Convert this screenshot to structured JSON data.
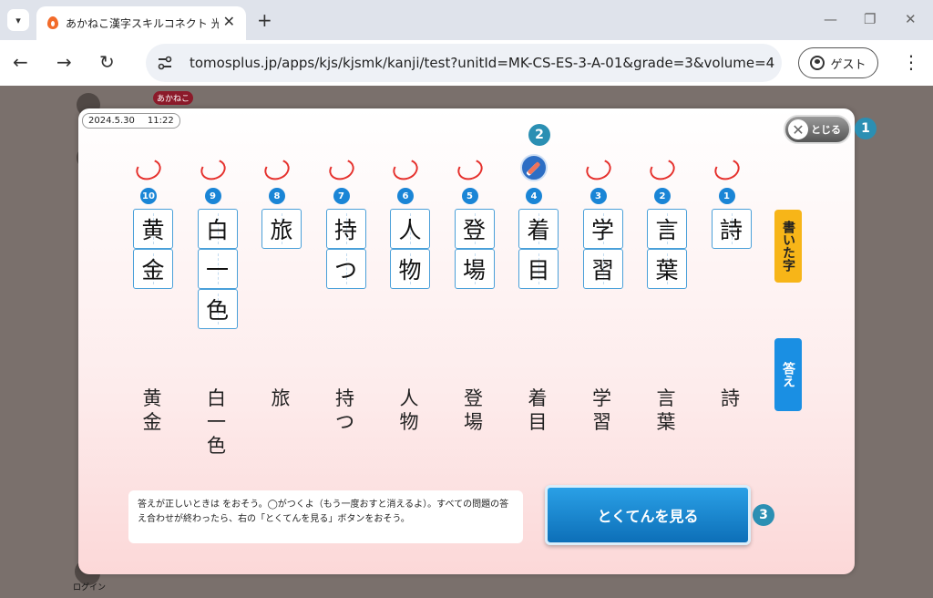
{
  "browser": {
    "tab_title": "あかねこ漢字スキルコネクト 光村",
    "url": "tomosplus.jp/apps/kjs/kjsmk/kanji/test?unitId=MK-CS-ES-3-A-01&grade=3&volume=4",
    "guest_label": "ゲスト"
  },
  "background": {
    "logo_text": "あかねこ",
    "login_label": "ログイン"
  },
  "modal": {
    "date": "2024.5.30",
    "time": "11:22",
    "close_label": "とじる",
    "callouts": [
      "1",
      "2",
      "3"
    ],
    "written_tab_label": "書いた字",
    "answer_tab_label": "答え",
    "instruction_text": "答えが正しいときは をおそう。◯がつくよ（もう一度おすと消えるよ）。すべての問題の答え合わせが終わったら、右の「とくてんを見る」ボタンをおそう。",
    "score_button_label": "とくてんを見る",
    "questions": [
      {
        "num": "10",
        "written": [
          "黄",
          "金"
        ],
        "answer": "黄金",
        "marked": true
      },
      {
        "num": "9",
        "written": [
          "白",
          "一",
          "色"
        ],
        "answer": "白一色",
        "marked": true
      },
      {
        "num": "8",
        "written": [
          "旅"
        ],
        "answer": "旅",
        "marked": true
      },
      {
        "num": "7",
        "written": [
          "持",
          "つ"
        ],
        "answer": "持つ",
        "marked": true
      },
      {
        "num": "6",
        "written": [
          "人",
          "物"
        ],
        "answer": "人物",
        "marked": true
      },
      {
        "num": "5",
        "written": [
          "登",
          "場"
        ],
        "answer": "登場",
        "marked": true
      },
      {
        "num": "4",
        "written": [
          "着",
          "目"
        ],
        "answer": "着目",
        "marked": false
      },
      {
        "num": "3",
        "written": [
          "学",
          "習"
        ],
        "answer": "学習",
        "marked": true
      },
      {
        "num": "2",
        "written": [
          "言",
          "葉"
        ],
        "answer": "言葉",
        "marked": true
      },
      {
        "num": "1",
        "written": [
          "詩"
        ],
        "answer": "詩",
        "marked": true
      }
    ]
  }
}
